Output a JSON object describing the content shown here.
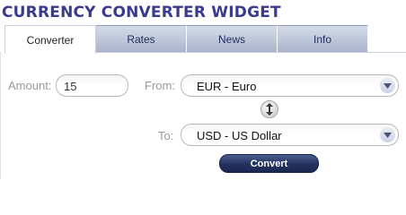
{
  "widget": {
    "title": "CURRENCY CONVERTER WIDGET"
  },
  "tabs": [
    {
      "label": "Converter",
      "active": true
    },
    {
      "label": "Rates",
      "active": false
    },
    {
      "label": "News",
      "active": false
    },
    {
      "label": "Info",
      "active": false
    }
  ],
  "form": {
    "amount_label": "Amount:",
    "amount_value": "15",
    "from_label": "From:",
    "from_value": "EUR - Euro",
    "to_label": "To:",
    "to_value": "USD - US Dollar",
    "convert_label": "Convert"
  },
  "colors": {
    "title": "#3b3a8c",
    "tab_inactive": "#b8c1d8",
    "button": "#23325e"
  },
  "icons": {
    "swap": "swap-vertical-icon",
    "dropdown": "chevron-down-icon"
  }
}
